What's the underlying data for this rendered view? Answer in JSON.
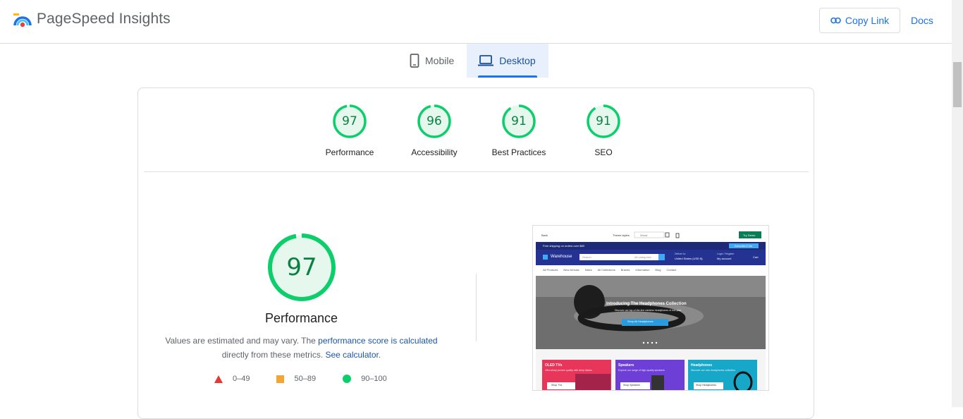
{
  "header": {
    "title": "PageSpeed Insights",
    "copy_link": "Copy Link",
    "docs": "Docs"
  },
  "tabs": [
    {
      "label": "Mobile",
      "icon": "phone-icon",
      "active": false
    },
    {
      "label": "Desktop",
      "icon": "laptop-icon",
      "active": true
    }
  ],
  "scores": [
    {
      "value": "97",
      "label": "Performance"
    },
    {
      "value": "96",
      "label": "Accessibility"
    },
    {
      "value": "91",
      "label": "Best Practices"
    },
    {
      "value": "91",
      "label": "SEO"
    }
  ],
  "performance": {
    "score": "97",
    "title": "Performance",
    "text_1": "Values are estimated and may vary. The ",
    "link_1": "performance score is calculated",
    "text_2": "directly from these metrics. ",
    "link_2": "See calculator",
    "text_3": "."
  },
  "legend": [
    {
      "range": "0–49",
      "shape": "triangle",
      "color": "#e53935"
    },
    {
      "range": "50–89",
      "shape": "square",
      "color": "#f4a532"
    },
    {
      "range": "90–100",
      "shape": "circle",
      "color": "#0cce6b"
    }
  ],
  "colors": {
    "pass": "#0cce6b",
    "pass_text": "#0b8043",
    "pass_fill": "#e6f8ee",
    "accent": "#1a73e8"
  },
  "screenshot": {
    "back": "Back",
    "preview_label": "Theme styles",
    "preview_select": "Wood",
    "try_demo": "Try Demo",
    "announcement": "Free shipping on orders over $80",
    "subscribe": "Subscribe 5 Vex",
    "store_name": "Warehouse",
    "search_placeholder": "Search",
    "category_select": "All categories",
    "deliver_label": "Deliver to:",
    "deliver_value": "United States (USD $)",
    "login_label": "Login / Register",
    "account": "My account",
    "cart": "Cart",
    "nav": [
      "All Products",
      "New Arrivals",
      "Sales",
      "All Collections",
      "Brands",
      "Information",
      "Blog",
      "Contact"
    ],
    "hero_title": "Introducing The Headphones Collection",
    "hero_sub": "Discover our top-of-the-line wireless headphones of this year",
    "hero_button": "Shop All Headphones",
    "tiles": [
      {
        "title": "OLED TVs",
        "text": "Ultra-sharp picture quality with deep blacks",
        "button": "Shop TVs",
        "color": "#e8355a"
      },
      {
        "title": "Speakers",
        "text": "Explore our range of high-quality speakers",
        "button": "Shop Speakers",
        "color": "#6d3fd6"
      },
      {
        "title": "Headphones",
        "text": "Discover our new headphones collection",
        "button": "Shop Headphones",
        "color": "#16a7c9"
      }
    ]
  }
}
